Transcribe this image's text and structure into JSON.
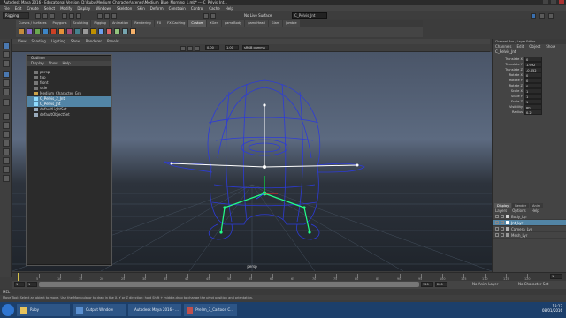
{
  "window": {
    "title": "Autodesk Maya 2016 - Educational Version: D:\\Ruby\\Medium_Character\\scenes\\Medium_Blue_Morning_1.mb* --- C_Pelvis_Jnt..."
  },
  "menubar": [
    "File",
    "Edit",
    "Create",
    "Select",
    "Modify",
    "Display",
    "Windows",
    "Skeleton",
    "Skin",
    "Deform",
    "Constrain",
    "Control",
    "Cache",
    "Help"
  ],
  "status": {
    "mode": "Rigging",
    "no_live": "No Live Surface",
    "name_field": "C_Pelvis_Jnt"
  },
  "shelf_tabs": [
    "Curves / Surfaces",
    "Polygons",
    "Sculpting",
    "Rigging",
    "Animation",
    "Rendering",
    "FX",
    "FX Caching",
    "Custom",
    "XGen",
    "gameBody",
    "gameHead",
    "Glam",
    "Jombie"
  ],
  "shelf_active": 8,
  "panel_menu": [
    "View",
    "Shading",
    "Lighting",
    "Show",
    "Renderer",
    "Panels"
  ],
  "panel_fields": {
    "near": "0.00",
    "far": "1.00",
    "color_mgmt": "sRGB gamma"
  },
  "viewport": {
    "camera_label": "persp"
  },
  "outliner": {
    "title": "Outliner",
    "menu": [
      "Display",
      "Show",
      "Help"
    ],
    "items": [
      {
        "label": "persp",
        "selected": false
      },
      {
        "label": "top",
        "selected": false
      },
      {
        "label": "front",
        "selected": false
      },
      {
        "label": "side",
        "selected": false
      },
      {
        "label": "Medium_Character_Grp",
        "selected": false
      },
      {
        "label": "C_Pelvis_2_Jnt",
        "selected": true
      },
      {
        "label": "C_Pelvis_Jnt",
        "selected": true
      },
      {
        "label": "defaultLightSet",
        "selected": false
      },
      {
        "label": "defaultObjectSet",
        "selected": false
      }
    ]
  },
  "channel_box": {
    "title": "Channel Box / Layer Editor",
    "menu": [
      "Channels",
      "Edit",
      "Object",
      "Show"
    ],
    "object": "C_Pelvis_Jnt",
    "attributes": [
      {
        "name": "Translate X",
        "value": "0"
      },
      {
        "name": "Translate Y",
        "value": "1.992"
      },
      {
        "name": "Translate Z",
        "value": "-0.052"
      },
      {
        "name": "Rotate X",
        "value": "0"
      },
      {
        "name": "Rotate Y",
        "value": "0"
      },
      {
        "name": "Rotate Z",
        "value": "0"
      },
      {
        "name": "Scale X",
        "value": "1"
      },
      {
        "name": "Scale Y",
        "value": "1"
      },
      {
        "name": "Scale Z",
        "value": "1"
      },
      {
        "name": "Visibility",
        "value": "on"
      },
      {
        "name": "Radius",
        "value": "0.2"
      }
    ]
  },
  "layer_editor": {
    "tabs": [
      "Display",
      "Render",
      "Anim"
    ],
    "menu": [
      "Layers",
      "Options",
      "Help"
    ],
    "layers": [
      {
        "label": "Body_Lyr",
        "selected": false
      },
      {
        "label": "Jnt_Lyr",
        "selected": true
      },
      {
        "label": "Camera_Lyr",
        "selected": false
      },
      {
        "label": "Mesh_Lyr",
        "selected": false
      }
    ]
  },
  "timeline": {
    "ticks": [
      "5",
      "10",
      "15",
      "20",
      "25",
      "30",
      "35",
      "40",
      "45",
      "50",
      "55",
      "60",
      "65",
      "70",
      "75",
      "80",
      "85",
      "90",
      "95",
      "100",
      "105",
      "110",
      "115",
      "120"
    ],
    "current_frame": "1",
    "start": "1",
    "range_start": "1",
    "range_end": "120",
    "end": "200",
    "anim_layer": "No Anim Layer",
    "char_set": "No Character Set"
  },
  "command_line": {
    "label": "MEL"
  },
  "help_line": "Move Tool: Select an object to move. Use the Manipulator to drag in the X, Y or Z direction; hold Shift + middle-drag to change the pivot position and orientation.",
  "taskbar": {
    "items": [
      "Ruby",
      "Output Window",
      "Autodesk Maya 2016 - ...",
      "Prelim_3_Cartoon C..."
    ],
    "time": "13:17",
    "date": "08/01/2016"
  },
  "colors": {
    "selection": "#5285a6",
    "joint": "#22ff88",
    "wireframe": "#2d3bd8"
  }
}
